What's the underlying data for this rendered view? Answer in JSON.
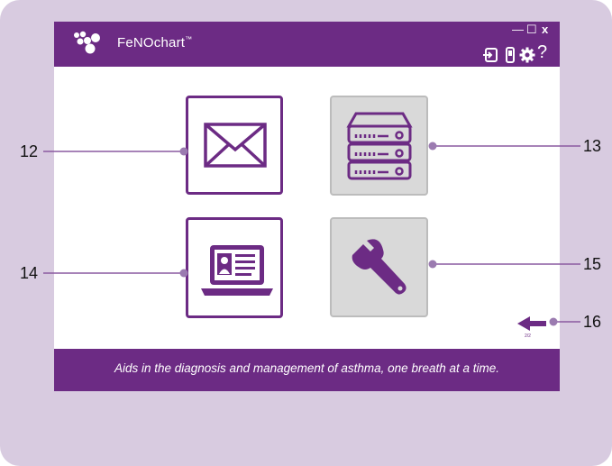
{
  "app": {
    "title": "FeNOchart",
    "trademark": "™"
  },
  "window_controls": {
    "minimize": "—",
    "maximize": "☐",
    "close": "x"
  },
  "toolbar": {
    "icons": [
      "logout-icon",
      "device-icon",
      "gear-icon",
      "help-icon"
    ],
    "help_glyph": "?"
  },
  "tiles": [
    {
      "name": "email",
      "icon": "envelope-icon",
      "style": "white"
    },
    {
      "name": "server",
      "icon": "server-icon",
      "style": "grey"
    },
    {
      "name": "online",
      "icon": "laptop-profile-icon",
      "style": "white"
    },
    {
      "name": "tools",
      "icon": "wrench-icon",
      "style": "grey"
    }
  ],
  "callouts": {
    "c12": "12",
    "c13": "13",
    "c14": "14",
    "c15": "15",
    "c16": "16"
  },
  "navigation": {
    "back_icon": "back-arrow-icon",
    "page_indicator": "2/2"
  },
  "footer": {
    "tagline": "Aids in the diagnosis and management of asthma, one breath at a time."
  },
  "colors": {
    "brand": "#6c2b84",
    "frame": "#d8cbe0",
    "tile_grey": "#d9d9d9"
  }
}
